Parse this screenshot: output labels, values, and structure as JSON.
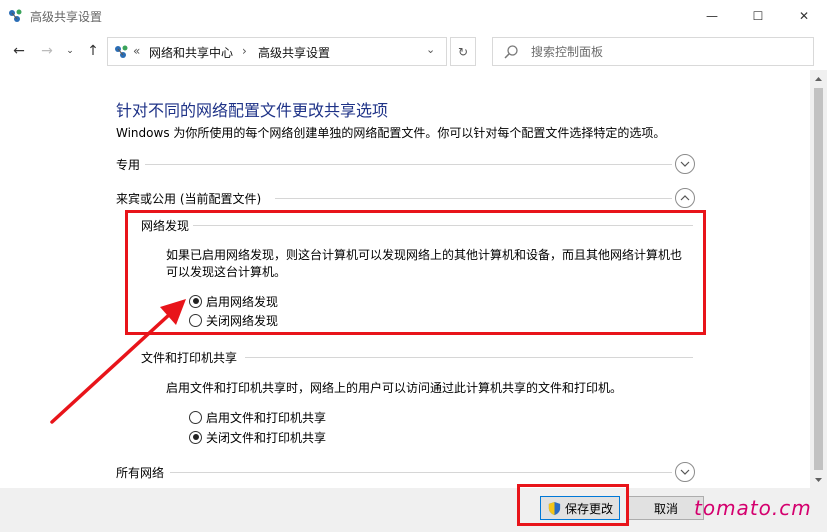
{
  "window": {
    "title": "高级共享设置",
    "minimize_glyph": "—",
    "maximize_glyph": "☐",
    "close_glyph": "✕"
  },
  "nav": {
    "back_glyph": "←",
    "forward_glyph": "→",
    "recent_glyph": "⌄",
    "up_glyph": "↑",
    "address": {
      "overflow": "«",
      "crumbs": [
        "网络和共享中心",
        "高级共享设置"
      ],
      "separator": "›",
      "dropdown_glyph": "⌄"
    },
    "refresh_glyph": "↻",
    "search_placeholder": "搜索控制面板"
  },
  "content": {
    "title": "针对不同的网络配置文件更改共享选项",
    "description": "Windows 为你所使用的每个网络创建单独的网络配置文件。你可以针对每个配置文件选择特定的选项。",
    "profiles": [
      {
        "label": "专用",
        "state": "collapsed"
      },
      {
        "label": "来宾或公用 (当前配置文件)",
        "state": "expanded"
      },
      {
        "label": "所有网络",
        "state": "collapsed"
      }
    ],
    "network_discovery": {
      "header": "网络发现",
      "description_line1": "如果已启用网络发现，则这台计算机可以发现网络上的其他计算机和设备，而且其他网络计算机也",
      "description_line2": "可以发现这台计算机。",
      "options": [
        {
          "label": "启用网络发现",
          "checked": true
        },
        {
          "label": "关闭网络发现",
          "checked": false
        }
      ]
    },
    "file_printer_sharing": {
      "header": "文件和打印机共享",
      "description": "启用文件和打印机共享时，网络上的用户可以访问通过此计算机共享的文件和打印机。",
      "options": [
        {
          "label": "启用文件和打印机共享",
          "checked": false
        },
        {
          "label": "关闭文件和打印机共享",
          "checked": true
        }
      ]
    }
  },
  "footer": {
    "save_label": "保存更改",
    "cancel_label": "取消"
  },
  "watermark": "tomato.cm",
  "colors": {
    "title_blue": "#1e3287",
    "annotation_red": "#e8141a",
    "watermark": "#d4006e"
  }
}
